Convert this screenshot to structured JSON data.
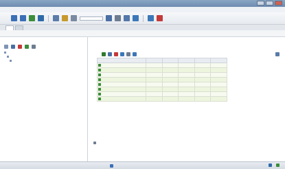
{
  "window": {
    "title": "",
    "controls": [
      "minimize",
      "maximize",
      "close"
    ]
  },
  "menubar": {
    "items": [
      "",
      "",
      "",
      "",
      ""
    ]
  },
  "toolbar": {
    "icons": [
      {
        "name": "back-icon",
        "color": "#3b6fb6"
      },
      {
        "name": "forward-icon",
        "color": "#3b6fb6"
      },
      {
        "name": "refresh-icon",
        "color": "#3c8d3c"
      },
      {
        "name": "home-icon",
        "color": "#2f6aa8"
      },
      {
        "name": "search-icon",
        "color": "#5a7ca8"
      },
      {
        "name": "favorites-icon",
        "color": "#c79a2d"
      },
      {
        "name": "history-icon",
        "color": "#7a8aa0"
      },
      {
        "name": "mail-icon",
        "color": "#4a6fa5"
      },
      {
        "name": "print-icon",
        "color": "#6d7c90"
      },
      {
        "name": "edit-icon",
        "color": "#5577aa"
      },
      {
        "name": "discuss-icon",
        "color": "#3c78b8"
      },
      {
        "name": "messenger-icon",
        "color": "#c43a3a"
      }
    ],
    "address_value": ""
  },
  "tabs": [
    {
      "label": "",
      "active": true
    },
    {
      "label": "",
      "active": false
    }
  ],
  "pathbar": {
    "items": [
      "",
      ""
    ]
  },
  "left_panel": {
    "header": "",
    "tree": [
      {
        "label": "",
        "level": 0,
        "selected": false
      },
      {
        "label": "",
        "level": 1,
        "selected": false
      },
      {
        "label": "",
        "level": 2,
        "selected": true
      }
    ]
  },
  "main": {
    "info": {
      "title": "",
      "line1": "",
      "line2": "",
      "line3": ""
    },
    "grid_toolbar_label": "",
    "columns": [
      "",
      "",
      "",
      "",
      "",
      ""
    ],
    "rows": [
      [
        "",
        "",
        "",
        "",
        "",
        ""
      ],
      [
        "",
        "",
        "",
        "",
        "",
        ""
      ],
      [
        "",
        "",
        "",
        "",
        "",
        ""
      ],
      [
        "",
        "",
        "",
        "",
        "",
        ""
      ],
      [
        "",
        "",
        "",
        "",
        "",
        ""
      ],
      [
        "",
        "",
        "",
        "",
        "",
        ""
      ],
      [
        "",
        "",
        "",
        "",
        "",
        ""
      ],
      [
        "",
        "",
        "",
        "",
        "",
        ""
      ]
    ],
    "footer_title": "",
    "footer_text": ""
  },
  "statusbar": {
    "text": "",
    "right_text": ""
  },
  "colors": {
    "titlebar": "#7b97bb",
    "grid_row": "#eef5df",
    "link": "#3366aa"
  }
}
